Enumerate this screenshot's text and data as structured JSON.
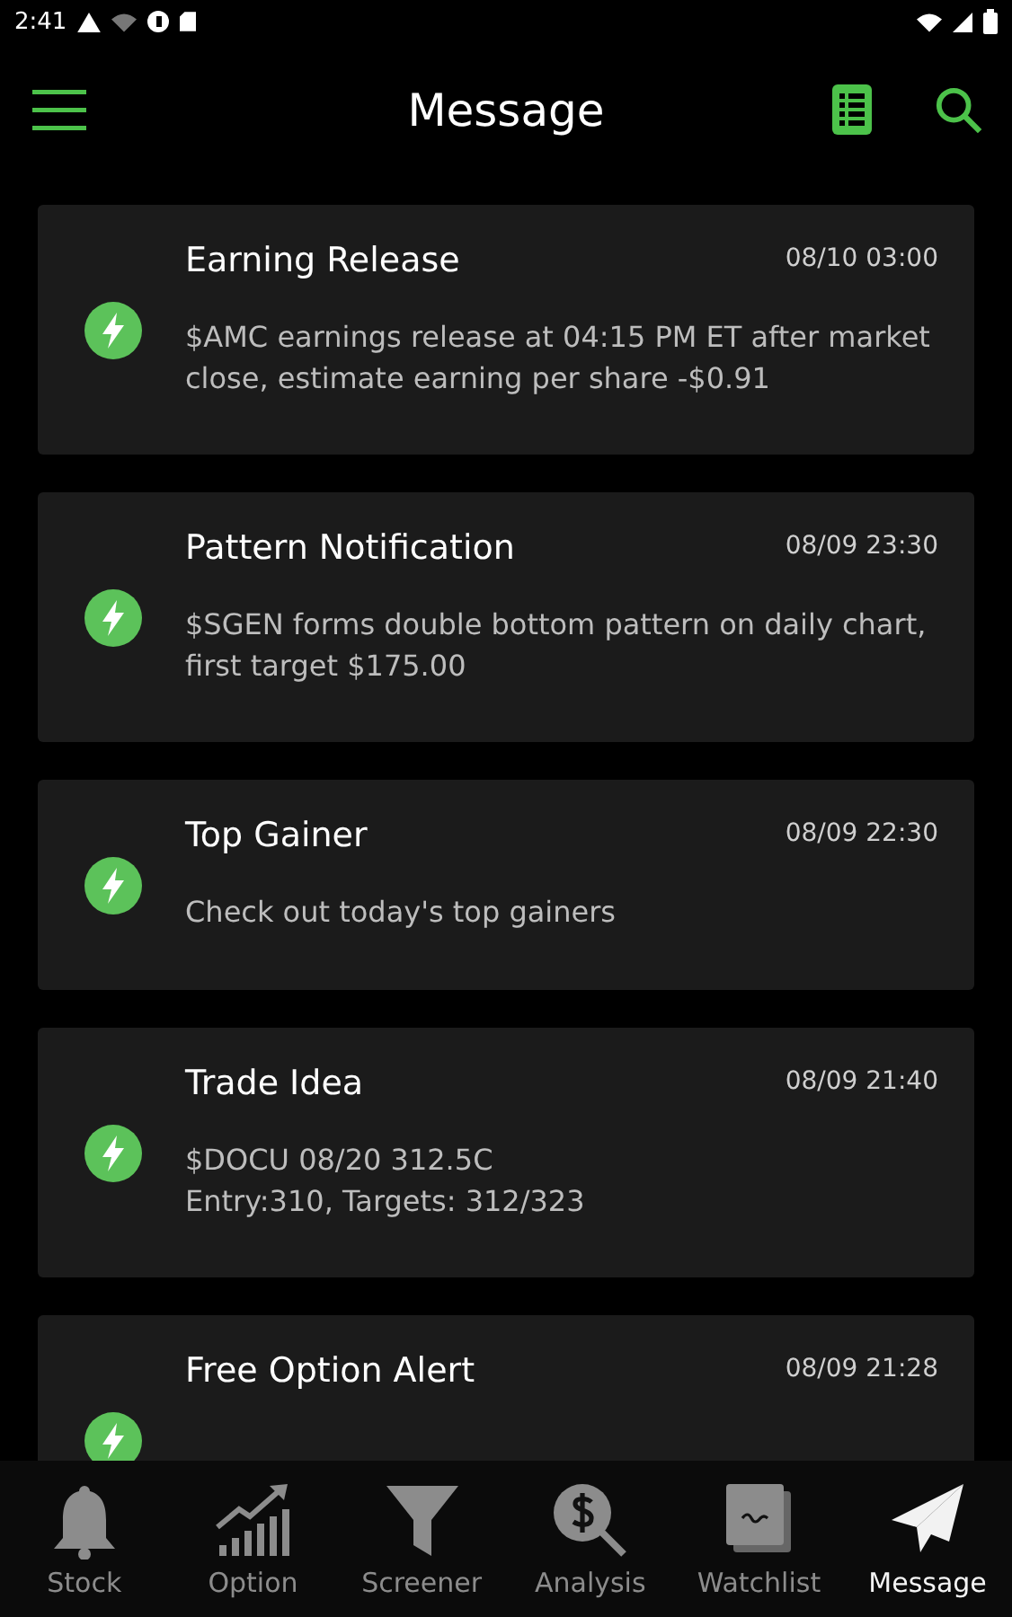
{
  "status_bar": {
    "time": "2:41"
  },
  "header": {
    "title": "Message"
  },
  "messages": [
    {
      "title": "Earning Release",
      "time": "08/10 03:00",
      "body": "$AMC earnings release at 04:15 PM ET after market close, estimate earning per share -$0.91"
    },
    {
      "title": "Pattern Notification",
      "time": "08/09 23:30",
      "body": "$SGEN forms double bottom pattern on daily chart, first target $175.00"
    },
    {
      "title": "Top Gainer",
      "time": "08/09 22:30",
      "body": "Check out today's top gainers"
    },
    {
      "title": "Trade Idea",
      "time": "08/09 21:40",
      "body": "$DOCU 08/20 312.5C\nEntry:310, Targets: 312/323"
    },
    {
      "title": "Free Option Alert",
      "time": "08/09 21:28"
    }
  ],
  "tabs": [
    {
      "kind": "bell",
      "label": "Stock",
      "selected": false
    },
    {
      "kind": "chart",
      "label": "Option",
      "selected": false
    },
    {
      "kind": "funnel",
      "label": "Screener",
      "selected": false
    },
    {
      "kind": "dollar",
      "label": "Analysis",
      "selected": false
    },
    {
      "kind": "note",
      "label": "Watchlist",
      "selected": false
    },
    {
      "kind": "plane",
      "label": "Message",
      "selected": true
    }
  ]
}
